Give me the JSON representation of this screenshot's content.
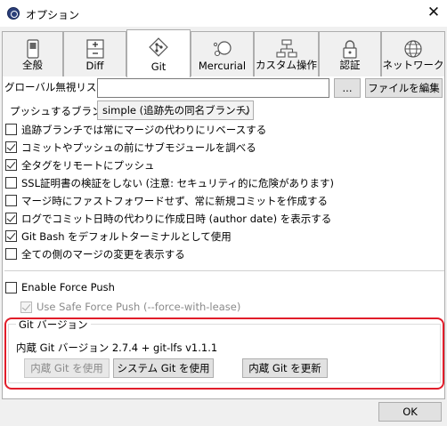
{
  "window": {
    "title": "オプション",
    "close_glyph": "✕",
    "app_icon": "git-extensions-icon"
  },
  "tabs": [
    {
      "label": "全般",
      "icon": "switch-icon",
      "active": false
    },
    {
      "label": "Diff",
      "icon": "diff-icon",
      "active": false
    },
    {
      "label": "Git",
      "icon": "git-icon",
      "active": true
    },
    {
      "label": "Mercurial",
      "icon": "mercurial-icon",
      "active": false
    },
    {
      "label": "カスタム操作",
      "icon": "custom-actions-icon",
      "active": false
    },
    {
      "label": "認証",
      "icon": "lock-icon",
      "active": false
    },
    {
      "label": "ネットワーク",
      "icon": "globe-icon",
      "active": false
    }
  ],
  "ignore": {
    "label": "グローバル無視リスト:",
    "value": "",
    "browse_label": "...",
    "edit_label": "ファイルを編集"
  },
  "push": {
    "label": "プッシュするブランチ:",
    "selected": "simple (追跡先の同名ブランチ)"
  },
  "options": [
    {
      "label": "追跡ブランチでは常にマージの代わりにリベースする",
      "checked": false
    },
    {
      "label": "コミットやプッシュの前にサブモジュールを調べる",
      "checked": true
    },
    {
      "label": "全タグをリモートにプッシュ",
      "checked": true
    },
    {
      "label": "SSL証明書の検証をしない (注意: セキュリティ的に危険があります)",
      "checked": false
    },
    {
      "label": "マージ時にファストフォワードせず、常に新規コミットを作成する",
      "checked": false
    },
    {
      "label": "ログでコミット日時の代わりに作成日時 (author date) を表示する",
      "checked": true
    },
    {
      "label": "Git Bash をデフォルトターミナルとして使用",
      "checked": true
    },
    {
      "label": "全ての側のマージの変更を表示する",
      "checked": false
    }
  ],
  "force_push": {
    "enable_label": "Enable Force Push",
    "enable_checked": false,
    "lease_label": "Use Safe Force Push (--force-with-lease)",
    "lease_checked": true
  },
  "git_version": {
    "group_title": "Git バージョン",
    "text": "内蔵 Git バージョン 2.7.4 + git-lfs v1.1.1",
    "use_builtin_label": "内蔵 Git を使用",
    "use_system_label": "システム Git を使用",
    "update_builtin_label": "内蔵 Git を更新"
  },
  "footer": {
    "ok_label": "OK"
  },
  "colors": {
    "highlight": "#e11d2a",
    "panel": "#ffffff",
    "chrome": "#f0f0f0"
  }
}
